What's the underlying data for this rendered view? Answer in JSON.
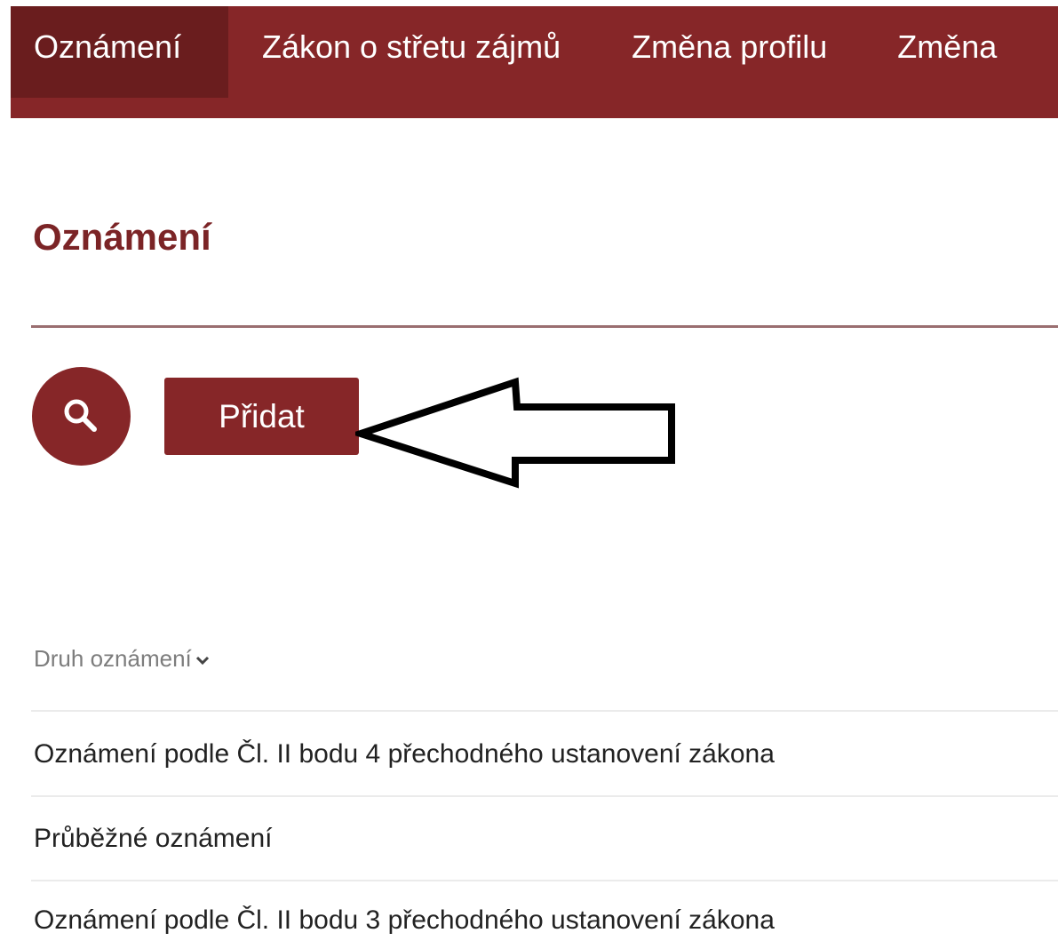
{
  "nav": {
    "tabs": [
      {
        "label": "Oznámení",
        "active": true
      },
      {
        "label": "Zákon o střetu zájmů",
        "active": false
      },
      {
        "label": "Změna profilu",
        "active": false
      },
      {
        "label": "Změna",
        "active": false
      }
    ]
  },
  "page": {
    "title": "Oznámení"
  },
  "toolbar": {
    "search_icon": "search-icon",
    "add_label": "Přidat"
  },
  "list": {
    "column_header": "Druh oznámení",
    "sort_icon": "chevron-down-icon",
    "rows": [
      "Oznámení podle Čl. II bodu 4 přechodného ustanovení zákona",
      "Průběžné oznámení",
      "Oznámení podle Čl. II bodu 3 přechodného ustanovení zákona"
    ]
  },
  "colors": {
    "brand": "#862628",
    "brand_dark": "#6a1d1e",
    "title": "#7b2426"
  }
}
